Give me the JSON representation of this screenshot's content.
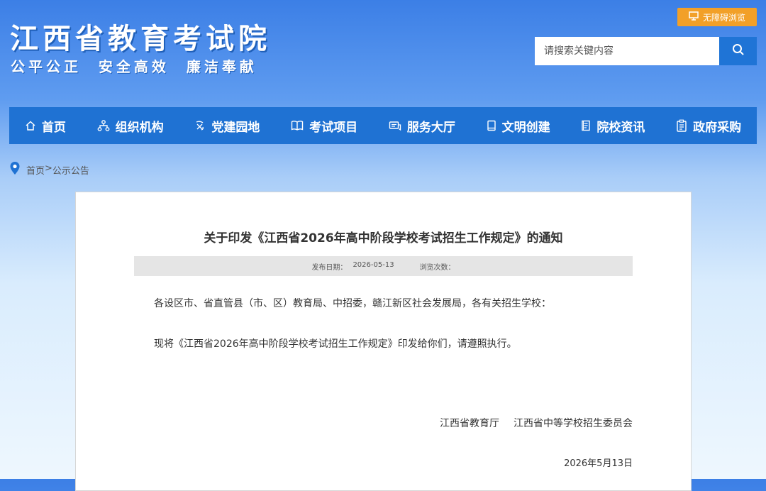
{
  "header": {
    "site_title": "江西省教育考试院",
    "slogan": "公平公正  安全高效  廉洁奉献",
    "accessibility_label": "无障碍浏览",
    "search_placeholder": "请搜索关键内容"
  },
  "nav": {
    "items": [
      {
        "label": "首页",
        "icon": "home-icon"
      },
      {
        "label": "组织机构",
        "icon": "org-chart-icon"
      },
      {
        "label": "党建园地",
        "icon": "party-building-icon"
      },
      {
        "label": "考试项目",
        "icon": "book-icon"
      },
      {
        "label": "服务大厅",
        "icon": "service-icon"
      },
      {
        "label": "文明创建",
        "icon": "notebook-icon"
      },
      {
        "label": "院校资讯",
        "icon": "document-icon"
      },
      {
        "label": "政府采购",
        "icon": "clipboard-icon"
      }
    ]
  },
  "breadcrumb": {
    "home": "首页",
    "separator": ">",
    "current": "公示公告"
  },
  "article": {
    "title": "关于印发《江西省2026年高中阶段学校考试招生工作规定》的通知",
    "publish_label": "发布日期：",
    "publish_date": "2026-05-13",
    "views_label": "浏览次数：",
    "recipients": "各设区市、省直管县（市、区）教育局、中招委，赣江新区社会发展局，各有关招生学校：",
    "paragraph": "现将《江西省2026年高中阶段学校考试招生工作规定》印发给你们，请遵照执行。",
    "signature_org1": "江西省教育厅",
    "signature_org2": "江西省中等学校招生委员会",
    "signature_date": "2026年5月13日"
  },
  "colors": {
    "nav_bg": "#1f72d3",
    "accessibility_btn": "#f2a028",
    "search_btn": "#1f74d6"
  }
}
